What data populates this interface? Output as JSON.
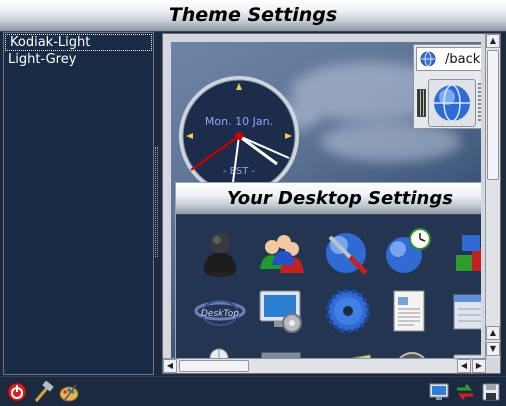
{
  "window": {
    "title": "Theme Settings"
  },
  "themes": [
    {
      "label": "Kodiak-Light",
      "selected": true
    },
    {
      "label": "Light-Grey",
      "selected": false
    }
  ],
  "preview": {
    "clock": {
      "date": "Mon. 10 Jan.",
      "zone": "- EST -"
    },
    "browser": {
      "url": "/backg",
      "icons": [
        "globe-icon",
        "globe-button-icon"
      ]
    },
    "desktop_settings": {
      "title": "Your Desktop Settings",
      "icons": [
        "user-silhouette-icon",
        "users-group-icon",
        "network-tools-icon",
        "internet-time-icon",
        "color-blocks-icon",
        "desktop-logo-icon",
        "display-settings-icon",
        "gear-icon",
        "document-icon",
        "file-manager-icon",
        "mouse-icon",
        "window-icon",
        "keyboard-icon",
        "speaker-icon",
        "screen-icon"
      ]
    }
  },
  "bottom_toolbar": {
    "left": [
      "power-icon",
      "hammer-icon",
      "paint-palette-icon"
    ],
    "right": [
      "monitor-icon",
      "swap-icon",
      "save-icon"
    ]
  },
  "colors": {
    "background": "#1b2a3f",
    "list_bg": "#1a2c45",
    "clock_hand": "#cc0000"
  }
}
